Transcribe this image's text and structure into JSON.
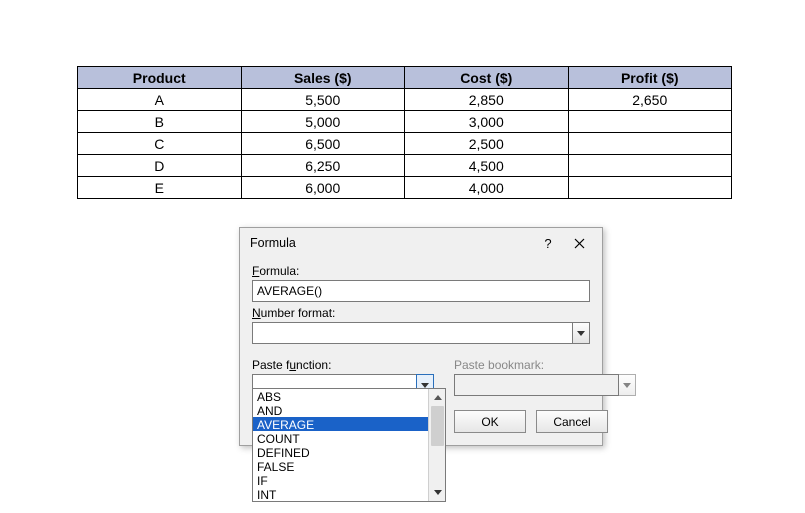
{
  "table": {
    "headers": [
      "Product",
      "Sales ($)",
      "Cost ($)",
      "Profit ($)"
    ],
    "rows": [
      {
        "product": "A",
        "sales": "5,500",
        "cost": "2,850",
        "profit": "2,650"
      },
      {
        "product": "B",
        "sales": "5,000",
        "cost": "3,000",
        "profit": ""
      },
      {
        "product": "C",
        "sales": "6,500",
        "cost": "2,500",
        "profit": ""
      },
      {
        "product": "D",
        "sales": "6,250",
        "cost": "4,500",
        "profit": ""
      },
      {
        "product": "E",
        "sales": "6,000",
        "cost": "4,000",
        "profit": ""
      }
    ]
  },
  "dialog": {
    "title": "Formula",
    "formula_label_pre": "F",
    "formula_label_u": "o",
    "formula_label_post": "rmula:",
    "formula_value": "AVERAGE()",
    "numfmt_label_pre": "N",
    "numfmt_label_u": "u",
    "numfmt_label_post": "mber format:",
    "numfmt_value": "",
    "pastefn_label_pre": "Paste f",
    "pastefn_label_u": "u",
    "pastefn_label_post": "nction:",
    "pastefn_value": "",
    "pastebm_label": "Paste bookmark:",
    "pastebm_value": "",
    "ok_label": "OK",
    "cancel_label": "Cancel",
    "function_list": [
      "ABS",
      "AND",
      "AVERAGE",
      "COUNT",
      "DEFINED",
      "FALSE",
      "IF",
      "INT"
    ],
    "selected_function_index": 2
  }
}
